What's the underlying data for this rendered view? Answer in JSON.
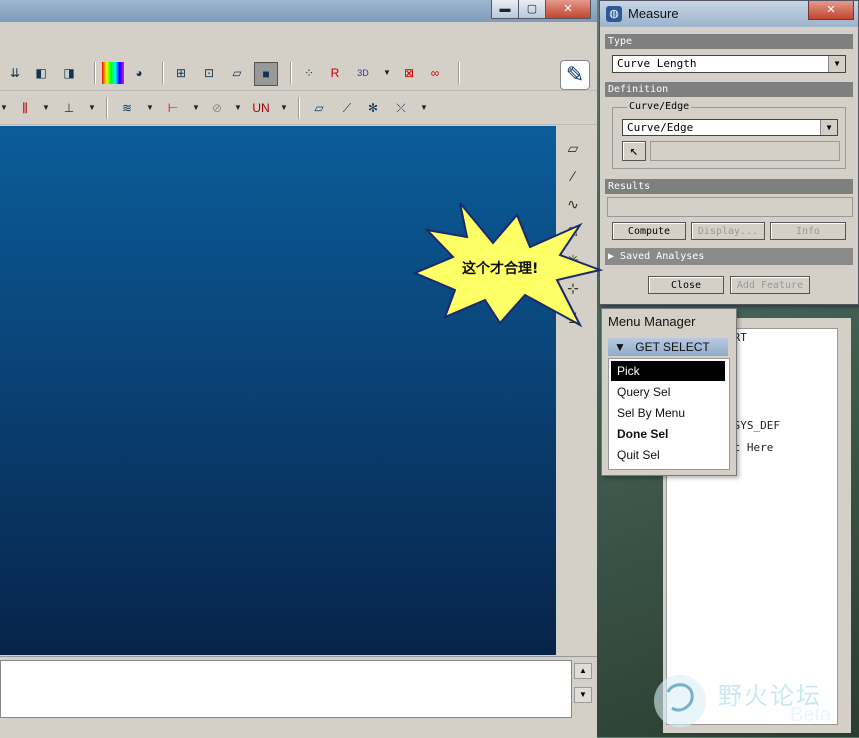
{
  "main": {
    "window_buttons": {
      "minimize": "▬",
      "maximize": "▢",
      "close": "✕"
    },
    "toolbar_row2_text": {
      "un_label": "UN"
    },
    "annotation": {
      "text": "这个才合理!"
    }
  },
  "measure": {
    "title": "Measure",
    "type_header": "Type",
    "type_value": "Curve Length",
    "definition_header": "Definition",
    "curve_group_label": "Curve/Edge",
    "curve_value": "Curve/Edge",
    "results_header": "Results",
    "buttons": {
      "compute": "Compute",
      "display": "Display...",
      "info": "Info"
    },
    "saved_analyses": "Saved Analyses",
    "bottom_buttons": {
      "close": "Close",
      "add_feature": "Add Feature"
    }
  },
  "menu_manager": {
    "title": "Menu Manager",
    "header": "GET SELECT",
    "items": [
      {
        "label": "Pick",
        "selected": true,
        "bold": false
      },
      {
        "label": "Query Sel",
        "selected": false,
        "bold": false
      },
      {
        "label": "Sel By Menu",
        "selected": false,
        "bold": false
      },
      {
        "label": "Done Sel",
        "selected": false,
        "bold": true
      },
      {
        "label": "Quit Sel",
        "selected": false,
        "bold": false
      }
    ]
  },
  "model_tree": {
    "lines": [
      "PRT",
      "T",
      "T",
      "CSYS_DEF",
      "rt Here"
    ]
  },
  "watermark": {
    "cn": "野火论坛",
    "beta": "Beta"
  },
  "colors": {
    "viewport_top": "#0b5d9a",
    "viewport_bottom": "#06244a",
    "burst": "#ffff66"
  },
  "icons": [
    "pointer-icon",
    "datum-plane-icon",
    "axis-icon",
    "curve-icon",
    "sketch-icon"
  ]
}
